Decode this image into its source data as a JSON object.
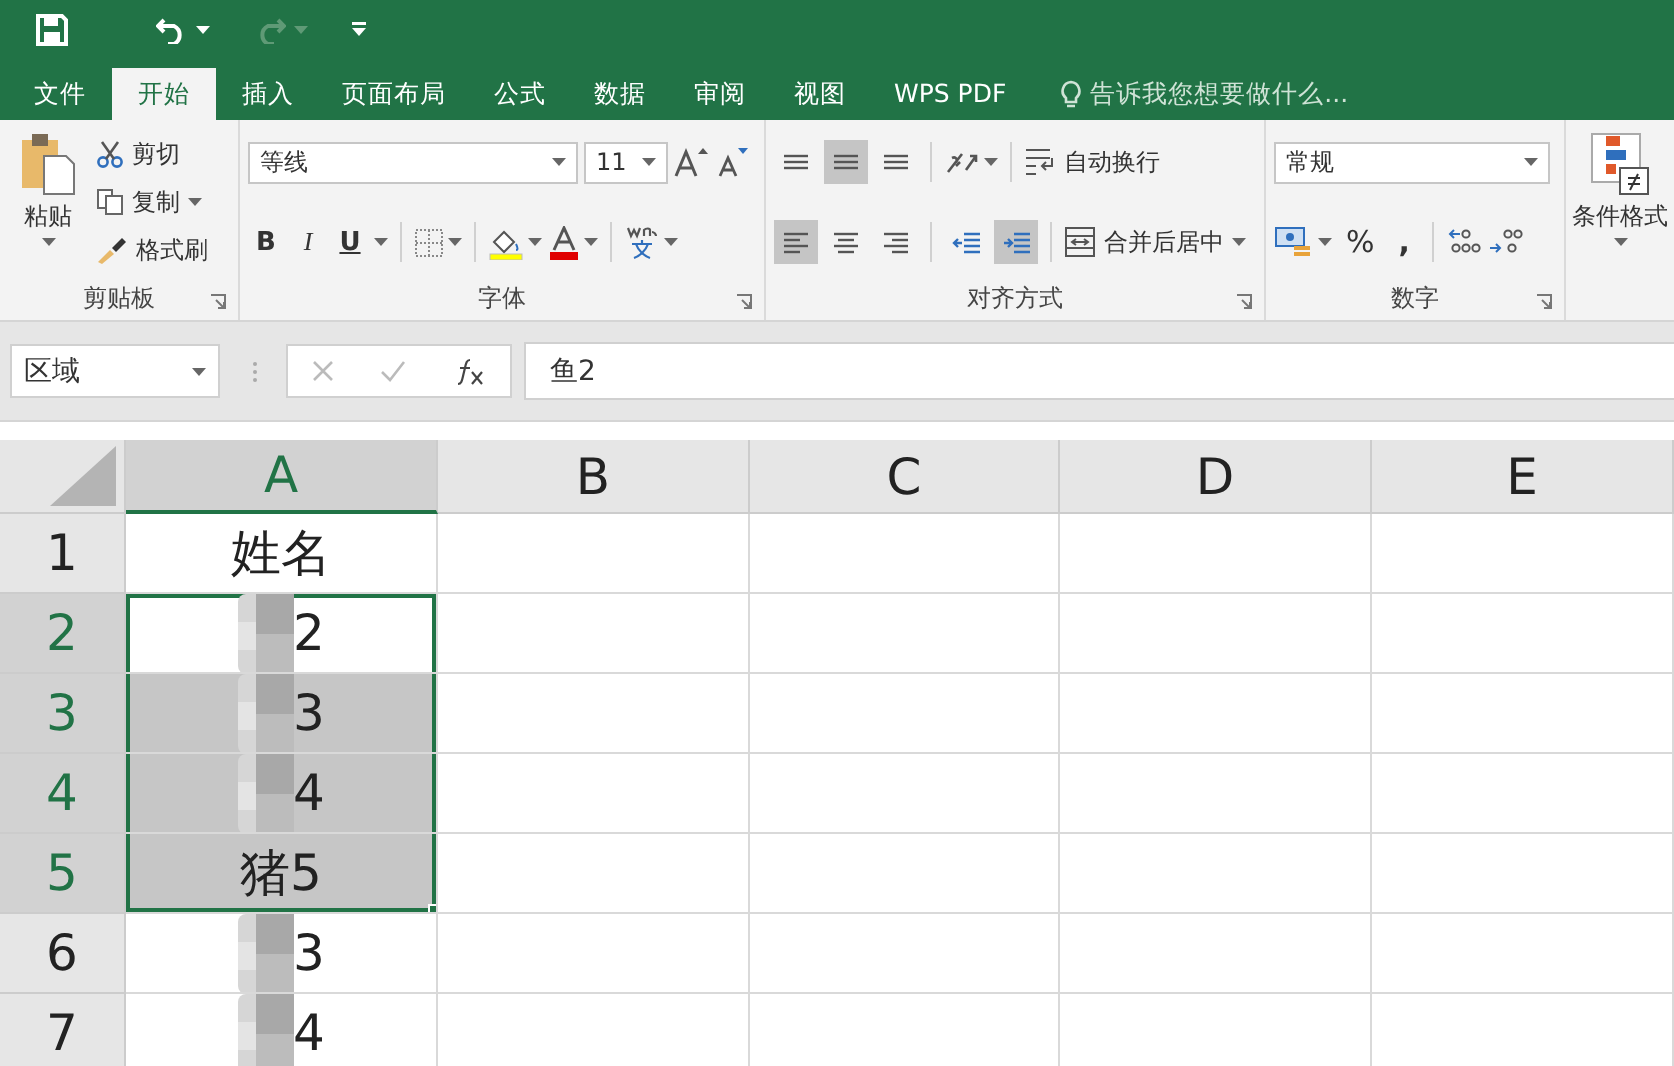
{
  "title_bar": {
    "redo_enabled": false
  },
  "tabs": [
    {
      "label": "文件",
      "selected": false
    },
    {
      "label": "开始",
      "selected": true
    },
    {
      "label": "插入",
      "selected": false
    },
    {
      "label": "页面布局",
      "selected": false
    },
    {
      "label": "公式",
      "selected": false
    },
    {
      "label": "数据",
      "selected": false
    },
    {
      "label": "审阅",
      "selected": false
    },
    {
      "label": "视图",
      "selected": false
    },
    {
      "label": "WPS PDF",
      "selected": false
    }
  ],
  "tell_me": {
    "placeholder": "告诉我您想要做什么..."
  },
  "clipboard": {
    "label": "剪贴板",
    "paste": "粘贴",
    "cut": "剪切",
    "copy": "复制",
    "format_painter": "格式刷"
  },
  "font": {
    "label": "字体",
    "font_name": "等线",
    "font_size": "11",
    "styles": [
      {
        "label": "B",
        "kind": "bold"
      },
      {
        "label": "I",
        "kind": "italic"
      },
      {
        "label": "U",
        "kind": "underline"
      }
    ]
  },
  "alignment": {
    "label": "对齐方式",
    "wrap_text": "自动换行",
    "merge_center": "合并后居中",
    "vertical": [
      {
        "selected": false
      },
      {
        "selected": true
      },
      {
        "selected": false
      }
    ],
    "horizontal": [
      {
        "selected": true
      },
      {
        "selected": false
      },
      {
        "selected": false
      }
    ],
    "indent": [
      {
        "selected": false
      },
      {
        "selected": true
      }
    ]
  },
  "number": {
    "label": "数字",
    "format": "常规",
    "percent": "%",
    "comma": ","
  },
  "styles": {
    "conditional_format": "条件格式"
  },
  "formula_bar": {
    "name_box": "区域",
    "formula": "鱼2"
  },
  "sheet": {
    "columns": [
      {
        "label": "A",
        "selected": true
      },
      {
        "label": "B",
        "selected": false
      },
      {
        "label": "C",
        "selected": false
      },
      {
        "label": "D",
        "selected": false
      },
      {
        "label": "E",
        "selected": false
      }
    ],
    "rows": [
      {
        "header": "1",
        "selected": false,
        "cell": {
          "text": "姓名",
          "selected": false,
          "active": false,
          "obscured": false
        }
      },
      {
        "header": "2",
        "selected": true,
        "cell": {
          "text": "2",
          "selected": true,
          "active": true,
          "obscured": true
        }
      },
      {
        "header": "3",
        "selected": true,
        "cell": {
          "text": "3",
          "selected": true,
          "active": false,
          "obscured": true
        }
      },
      {
        "header": "4",
        "selected": true,
        "cell": {
          "text": "4",
          "selected": true,
          "active": false,
          "obscured": true
        }
      },
      {
        "header": "5",
        "selected": true,
        "cell": {
          "text": "猪5",
          "selected": true,
          "active": false,
          "obscured": false
        }
      },
      {
        "header": "6",
        "selected": false,
        "cell": {
          "text": "3",
          "selected": false,
          "active": false,
          "obscured": true
        }
      },
      {
        "header": "7",
        "selected": false,
        "cell": {
          "text": "4",
          "selected": false,
          "active": false,
          "obscured": true
        }
      }
    ]
  }
}
